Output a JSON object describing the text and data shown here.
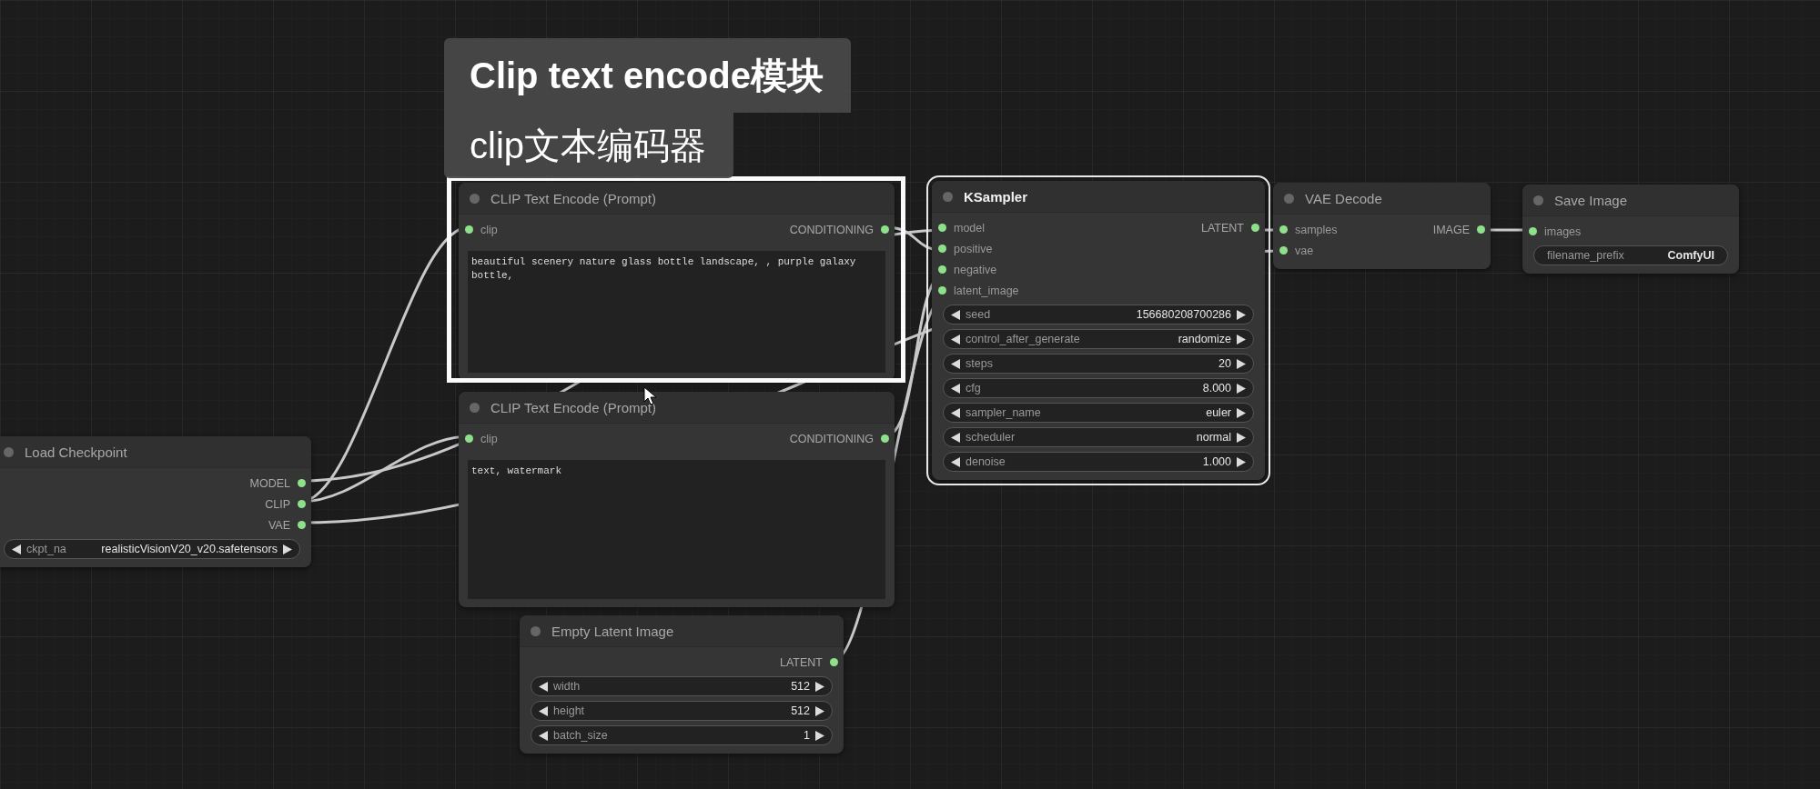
{
  "caption": {
    "title": "Clip text encode模块",
    "subtitle": "clip文本编码器"
  },
  "nodes": [
    {
      "title": "Load Checkpoint",
      "selected": false,
      "outputs": [
        "MODEL",
        "CLIP",
        "VAE"
      ],
      "widgets": [
        {
          "kind": "stepper",
          "label": "ckpt_na",
          "value": "realisticVisionV20_v20.safetensors"
        }
      ]
    },
    {
      "title": "CLIP Text Encode (Prompt)",
      "selected": false,
      "inputs": [
        "clip"
      ],
      "outputs": [
        "CONDITIONING"
      ],
      "prompt": "beautiful scenery nature glass bottle landscape, , purple galaxy bottle,"
    },
    {
      "title": "CLIP Text Encode (Prompt)",
      "selected": false,
      "inputs": [
        "clip"
      ],
      "outputs": [
        "CONDITIONING"
      ],
      "prompt": "text, watermark"
    },
    {
      "title": "Empty Latent Image",
      "selected": false,
      "outputs": [
        "LATENT"
      ],
      "widgets": [
        {
          "kind": "stepper",
          "label": "width",
          "value": "512"
        },
        {
          "kind": "stepper",
          "label": "height",
          "value": "512"
        },
        {
          "kind": "stepper",
          "label": "batch_size",
          "value": "1"
        }
      ]
    },
    {
      "title": "KSampler",
      "selected": true,
      "inputs": [
        "model",
        "positive",
        "negative",
        "latent_image"
      ],
      "outputs": [
        "LATENT"
      ],
      "widgets": [
        {
          "kind": "stepper",
          "label": "seed",
          "value": "156680208700286"
        },
        {
          "kind": "stepper",
          "label": "control_after_generate",
          "value": "randomize"
        },
        {
          "kind": "stepper",
          "label": "steps",
          "value": "20"
        },
        {
          "kind": "stepper",
          "label": "cfg",
          "value": "8.000"
        },
        {
          "kind": "stepper",
          "label": "sampler_name",
          "value": "euler"
        },
        {
          "kind": "stepper",
          "label": "scheduler",
          "value": "normal"
        },
        {
          "kind": "stepper",
          "label": "denoise",
          "value": "1.000"
        }
      ]
    },
    {
      "title": "VAE Decode",
      "selected": false,
      "inputs": [
        "samples",
        "vae"
      ],
      "outputs": [
        "IMAGE"
      ]
    },
    {
      "title": "Save Image",
      "selected": false,
      "inputs": [
        "images"
      ],
      "widgets": [
        {
          "kind": "text",
          "label": "filename_prefix",
          "value": "ComfyUI"
        }
      ]
    }
  ]
}
